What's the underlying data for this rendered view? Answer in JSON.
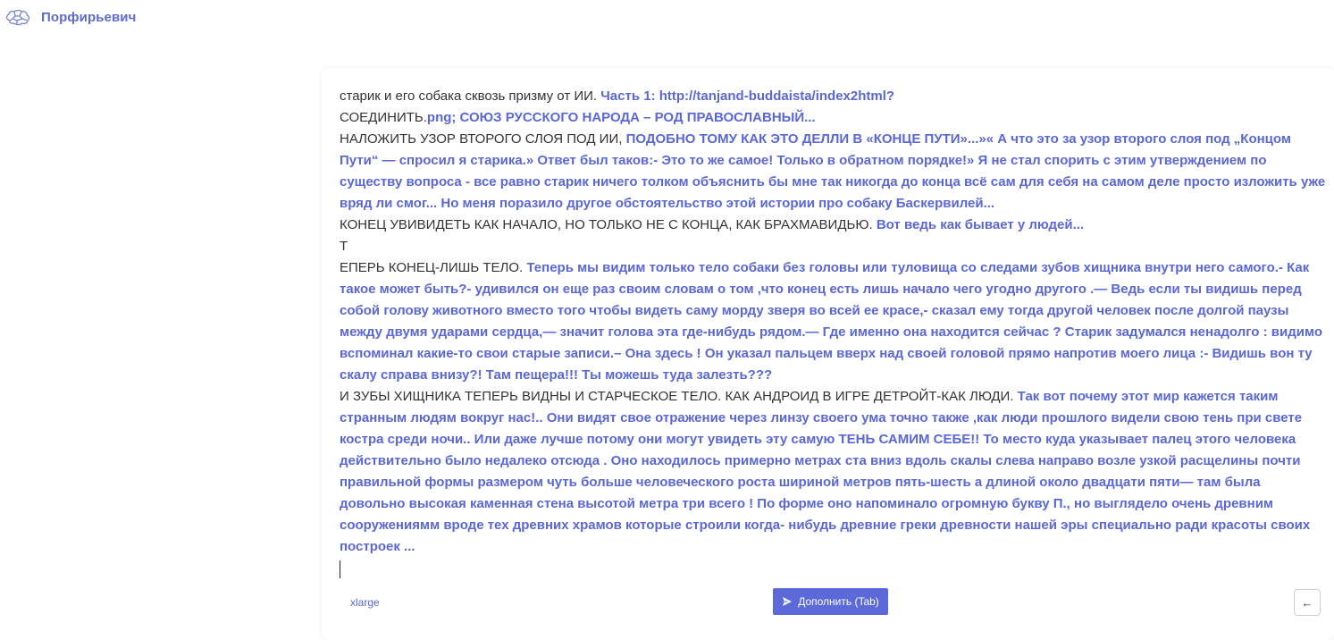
{
  "header": {
    "app_title": "Порфирьевич",
    "logo_icon": "brain-icon"
  },
  "editor": {
    "lines": [
      [
        {
          "kind": "usr",
          "text": "старик и его собака сквозь призму от ИИ. "
        },
        {
          "kind": "gen",
          "text": "Часть 1: http://tanjand-buddaista/index2html?"
        }
      ],
      [
        {
          "kind": "usr",
          "text": "СОЕДИНИТЬ."
        },
        {
          "kind": "gen",
          "text": "png; СОЮЗ РУССКОГО НАРОДА – РОД ПРАВОСЛАВНЫЙ..."
        }
      ],
      [
        {
          "kind": "usr",
          "text": "НАЛОЖИТЬ УЗОР ВТОРОГО СЛОЯ ПОД ИИ, "
        },
        {
          "kind": "gen",
          "text": "ПОДОБНО ТОМУ КАК ЭТО ДЕЛЛИ В «КОНЦЕ ПУТИ»...»« А что это за узор второго слоя под „Концом Пути“ — спросил я старика.» Ответ был таков:- Это то же самое! Только в обратном порядке!» Я не стал спорить с этим утверждением по существу вопроса - все равно старик ничего толком объяснить бы мне так никогда до конца всё сам для себя на самом деле просто изложить уже вряд ли смог... Но меня поразило другое обстоятельство этой истории про собаку Баскервилей..."
        }
      ],
      [
        {
          "kind": "usr",
          "text": "КОНЕЦ УВИВИДЕТЬ КАК НАЧАЛО, НО ТОЛЬКО НЕ С КОНЦА, КАК БРАХМАВИДЬЮ. "
        },
        {
          "kind": "gen",
          "text": "Вот ведь как бывает у людей..."
        }
      ],
      [
        {
          "kind": "usr",
          "text": "Т"
        }
      ],
      [
        {
          "kind": "usr",
          "text": "ЕПЕРЬ КОНЕЦ-ЛИШЬ ТЕЛО. "
        },
        {
          "kind": "gen",
          "text": "Теперь мы видим только тело собаки без головы или туловища со следами зубов хищника внутри него самого.- Как такое может быть?- удивился он еще раз своим словам о том ,что конец есть лишь начало чего угодно другого .— Ведь если ты видишь перед собой голову животного вместо того чтобы видеть саму морду зверя во всей ее красе,- сказал ему тогда другой человек после долгой паузы между двумя ударами сердца,— значит голова эта где-нибудь рядом.— Где именно она находится сейчас ? Старик задумался ненадолго : видимо вспоминал какие-то свои старые записи.– Она здесь ! Он указал пальцем вверх над своей головой прямо напротив моего лица :- Видишь вон ту скалу справа внизу?! Там пещера!!! Ты можешь туда залезть???"
        }
      ],
      [
        {
          "kind": "usr",
          "text": "И ЗУБЫ ХИЩНИКА ТЕПЕРЬ ВИДНЫ И СТАРЧЕСКОЕ ТЕЛО. КАК АНДРОИД В ИГРЕ ДЕТРОЙТ-КАК ЛЮДИ. "
        },
        {
          "kind": "gen",
          "text": "Так вот почему этот мир кажется таким странным людям вокруг нас!.. Они видят свое отражение через линзу своего ума точно также ,как люди прошлого видели свою тень при свете костра среди ночи.. Или даже лучше потому они могут увидеть эту самую ТЕНЬ САМИМ СЕБЕ!! То место куда указывает палец этого человека действительно было недалеко отсюда . Оно находилось примерно метрах ста вниз вдоль скалы слева направо возле узкой расщелины почти правильной формы размером чуть больше человеческого роста шириной метров пять-шесть а длиной около двадцати пяти— там была довольно высокая каменная стена высотой метра три всего ! По форме оно напоминало огромную букву П., но выглядело очень древним сооружениямм вроде тех древних храмов которые строили когда- нибудь древние греки древности нашей эры специально ради красоты своих построек ..."
        }
      ]
    ]
  },
  "footer": {
    "model_label": "xlarge",
    "complete_button_label": "Дополнить (Tab)",
    "complete_button_icon": "send-icon",
    "back_button_icon": "arrow-left-icon",
    "back_button_glyph": "←"
  },
  "colors": {
    "accent": "#5a67d8",
    "button_bg": "#5c6ad9",
    "user_text": "#333333"
  }
}
